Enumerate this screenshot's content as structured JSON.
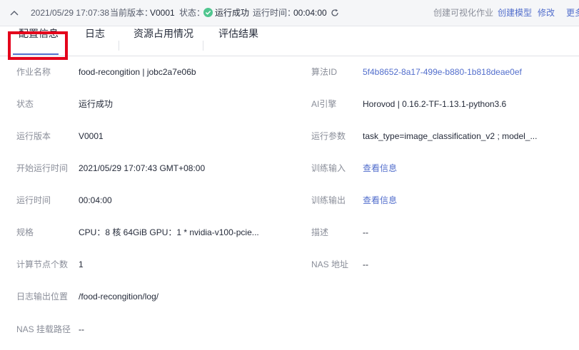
{
  "header": {
    "datetime": "2021/05/29 17:07:38",
    "version_label": "当前版本：",
    "version_value": "V0001",
    "status_label": "状态：",
    "status_value": "运行成功",
    "runtime_label": "运行时间：",
    "runtime_value": "00:04:00",
    "actions": {
      "create_visual_job": "创建可视化作业",
      "create_model": "创建模型",
      "modify": "修改",
      "more": "更多"
    },
    "icons": {
      "collapse": "chevron-up-icon",
      "status": "check-circle-icon",
      "refresh": "refresh-icon"
    },
    "colors": {
      "success": "#50c68f",
      "link": "#526ecc"
    }
  },
  "tabs": [
    {
      "label": "配置信息"
    },
    {
      "label": "日志"
    },
    {
      "label": "资源占用情况"
    },
    {
      "label": "评估结果"
    }
  ],
  "details": {
    "job_name_label": "作业名称",
    "job_name_value": "food-recongition | jobc2a7e06b",
    "algorithm_id_label": "算法ID",
    "algorithm_id_value": "5f4b8652-8a17-499e-b880-1b818deae0ef",
    "status_label": "状态",
    "status_value": "运行成功",
    "ai_engine_label": "AI引擎",
    "ai_engine_value": "Horovod | 0.16.2-TF-1.13.1-python3.6",
    "version_label": "运行版本",
    "version_value": "V0001",
    "params_label": "运行参数",
    "params_value": "task_type=image_classification_v2 ; model_...",
    "start_time_label": "开始运行时间",
    "start_time_value": "2021/05/29 17:07:43 GMT+08:00",
    "train_input_label": "训练输入",
    "train_input_value": "查看信息",
    "run_time_label": "运行时间",
    "run_time_value": "00:04:00",
    "train_output_label": "训练输出",
    "train_output_value": "查看信息",
    "spec_label": "规格",
    "spec_value": "CPU：8 核 64GiB GPU：1 * nvidia-v100-pcie...",
    "desc_label": "描述",
    "desc_value": "--",
    "nodes_label": "计算节点个数",
    "nodes_value": "1",
    "nas_addr_label": "NAS 地址",
    "nas_addr_value": "--",
    "log_path_label": "日志输出位置",
    "log_path_value": "/food-recongition/log/",
    "nas_mount_label": "NAS 挂载路径",
    "nas_mount_value": "--"
  }
}
